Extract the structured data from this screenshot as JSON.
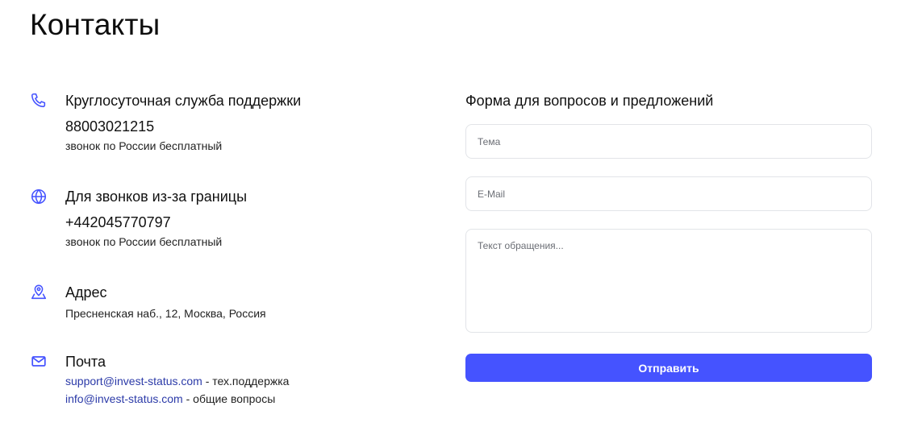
{
  "page": {
    "title": "Контакты"
  },
  "contacts": {
    "support": {
      "icon": "phone-icon",
      "heading": "Круглосуточная служба поддержки",
      "phone": "88003021215",
      "note": "звонок по России бесплатный"
    },
    "abroad": {
      "icon": "globe-icon",
      "heading": "Для звонков из-за границы",
      "phone": "+442045770797",
      "note": "звонок по России бесплатный"
    },
    "address": {
      "icon": "map-pin-icon",
      "heading": "Адрес",
      "value": "Пресненская наб., 12, Москва, Россия"
    },
    "mail": {
      "icon": "mail-icon",
      "heading": "Почта",
      "lines": [
        {
          "email": "support@invest-status.com",
          "suffix": " - тех.поддержка"
        },
        {
          "email": "info@invest-status.com",
          "suffix": " - общие вопросы"
        }
      ]
    }
  },
  "form": {
    "title": "Форма для вопросов и предложений",
    "subject": {
      "placeholder": "Тема",
      "value": ""
    },
    "email": {
      "placeholder": "E-Mail",
      "value": ""
    },
    "message": {
      "placeholder": "Текст обращения...",
      "value": ""
    },
    "submit_label": "Отправить"
  },
  "colors": {
    "accent": "#4553ff",
    "link": "#2b3aa8",
    "icon": "#4553ff",
    "border": "#e2e4e8"
  }
}
